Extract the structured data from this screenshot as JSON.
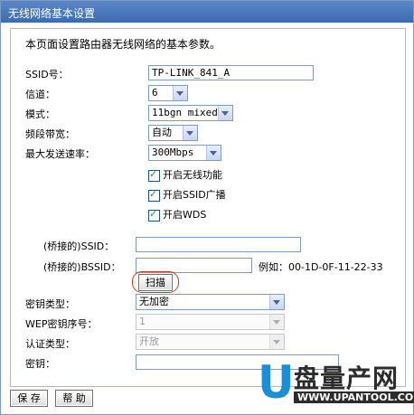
{
  "window": {
    "title": "无线网络基本设置"
  },
  "description": "本页面设置路由器无线网络的基本参数。",
  "form": {
    "ssid": {
      "label": "SSID号：",
      "value": "TP-LINK_841_A"
    },
    "channel": {
      "label": "信道：",
      "value": "6"
    },
    "mode": {
      "label": "模式：",
      "value": "11bgn mixed"
    },
    "bandwidth": {
      "label": "频段带宽：",
      "value": "自动"
    },
    "max_rate": {
      "label": "最大发送速率：",
      "value": "300Mbps"
    },
    "checkboxes": [
      {
        "label": "开启无线功能",
        "checked": true
      },
      {
        "label": "开启SSID广播",
        "checked": true
      },
      {
        "label": "开启WDS",
        "checked": true
      }
    ],
    "bridge_ssid": {
      "label": "(桥接的)SSID：",
      "value": ""
    },
    "bridge_bssid": {
      "label": "(桥接的)BSSID：",
      "value": "",
      "example": "例如：00-1D-0F-11-22-33"
    },
    "scan_button": "扫描",
    "key_type": {
      "label": "密钥类型：",
      "value": "无加密"
    },
    "wep_index": {
      "label": "WEP密钥序号：",
      "value": "1"
    },
    "auth_type": {
      "label": "认证类型：",
      "value": "开放"
    },
    "key": {
      "label": "密钥：",
      "value": ""
    }
  },
  "buttons": {
    "save": "保 存",
    "help": "帮 助"
  },
  "watermark": {
    "brand": "盘量产网",
    "url": "WWW.UPANTOOL.COM"
  }
}
